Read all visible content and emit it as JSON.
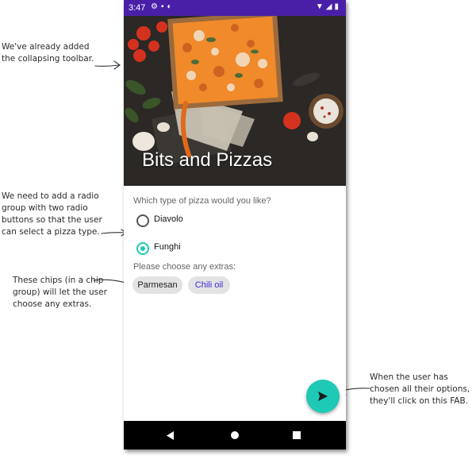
{
  "annotations": {
    "toolbar_note": [
      "We've already added",
      "the collapsing toolbar."
    ],
    "radio_note": [
      "We need to add a radio",
      "group with two radio",
      "buttons so that the user",
      "can select a pizza type."
    ],
    "chips_note": [
      "These chips (in a chip",
      "group) will let the user",
      "choose any extras."
    ],
    "fab_note": [
      "When the user has",
      "chosen all their options,",
      "they'll click on this FAB."
    ]
  },
  "status_bar": {
    "time": "3:47",
    "left_icons": [
      "gear-icon",
      "sd-card-icon",
      "app-badge-icon"
    ],
    "right_icons": [
      "wifi-icon",
      "signal-icon",
      "battery-icon"
    ],
    "color": "#4a1fa8"
  },
  "toolbar": {
    "title": "Bits and Pizzas"
  },
  "pizza_question": "Which type of pizza would you like?",
  "pizza_options": [
    {
      "label": "Diavolo",
      "checked": false
    },
    {
      "label": "Funghi",
      "checked": true
    }
  ],
  "extras_question": "Please choose any extras:",
  "extras_chips": [
    {
      "label": "Parmesan",
      "selected": false
    },
    {
      "label": "Chili oil",
      "selected": false
    }
  ],
  "fab": {
    "icon": "send-icon",
    "color": "#1ec9b5"
  },
  "nav_bar": {
    "icons": [
      "back-icon",
      "home-icon",
      "recents-icon"
    ]
  },
  "colors": {
    "accent": "#1ec9b5",
    "chip_bg": "#e3e3e3",
    "chili_text": "#3a2ad6"
  }
}
